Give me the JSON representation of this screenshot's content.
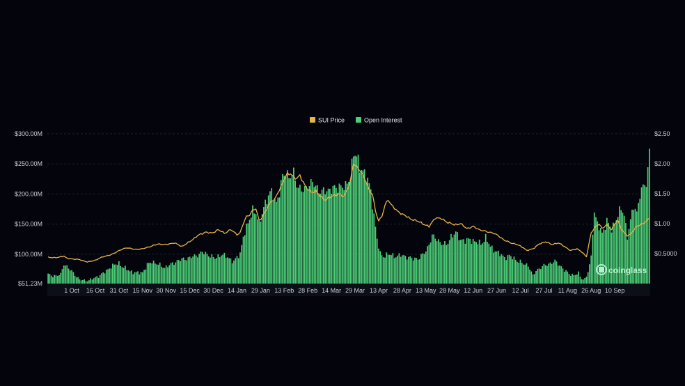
{
  "chart_data": {
    "type": "bar",
    "title": "",
    "legend": {
      "placement": "top-center",
      "items": [
        {
          "label": "SUI Price",
          "color": "#e8b44a"
        },
        {
          "label": "Open Interest",
          "color": "#4ccf78"
        }
      ]
    },
    "x_ticks": [
      "1 Oct",
      "16 Oct",
      "31 Oct",
      "15 Nov",
      "30 Nov",
      "15 Dec",
      "30 Dec",
      "14 Jan",
      "29 Jan",
      "13 Feb",
      "28 Feb",
      "14 Mar",
      "29 Mar",
      "13 Apr",
      "28 Apr",
      "13 May",
      "28 May",
      "12 Jun",
      "27 Jun",
      "12 Jul",
      "27 Jul",
      "11 Aug",
      "26 Aug",
      "10 Sep"
    ],
    "y_left": {
      "label": "",
      "ticks": [
        "$300.00M",
        "$250.00M",
        "$200.00M",
        "$150.00M",
        "$100.00M",
        "$51.23M"
      ],
      "tick_values": [
        300,
        250,
        200,
        150,
        100,
        51.23
      ],
      "range": [
        51.23,
        300
      ],
      "unit": "USD millions"
    },
    "y_right": {
      "label": "",
      "ticks": [
        "$2.50",
        "$2.00",
        "$1.50",
        "$1.00",
        "$0.5000"
      ],
      "tick_values": [
        2.5,
        2.0,
        1.5,
        1.0,
        0.5
      ],
      "range": [
        0,
        2.5
      ],
      "unit": "USD"
    },
    "grid": true,
    "series": [
      {
        "name": "Open Interest",
        "type": "bar",
        "axis": "left",
        "color": "#4ccf78",
        "anchors": [
          [
            0,
            66
          ],
          [
            3,
            64
          ],
          [
            8,
            66
          ],
          [
            10,
            84
          ],
          [
            12,
            80
          ],
          [
            14,
            74
          ],
          [
            17,
            66
          ],
          [
            20,
            58
          ],
          [
            23,
            56
          ],
          [
            26,
            57
          ],
          [
            30,
            61
          ],
          [
            34,
            67
          ],
          [
            37,
            72
          ],
          [
            40,
            80
          ],
          [
            45,
            85
          ],
          [
            48,
            78
          ],
          [
            52,
            72
          ],
          [
            56,
            69
          ],
          [
            60,
            70
          ],
          [
            63,
            82
          ],
          [
            66,
            88
          ],
          [
            70,
            83
          ],
          [
            74,
            78
          ],
          [
            78,
            83
          ],
          [
            82,
            89
          ],
          [
            86,
            92
          ],
          [
            90,
            94
          ],
          [
            94,
            98
          ],
          [
            98,
            103
          ],
          [
            102,
            99
          ],
          [
            106,
            93
          ],
          [
            110,
            100
          ],
          [
            114,
            95
          ],
          [
            118,
            88
          ],
          [
            122,
            101
          ],
          [
            124,
            130
          ],
          [
            127,
            150
          ],
          [
            130,
            175
          ],
          [
            132,
            168
          ],
          [
            134,
            148
          ],
          [
            137,
            180
          ],
          [
            140,
            195
          ],
          [
            142,
            205
          ],
          [
            145,
            185
          ],
          [
            147,
            200
          ],
          [
            149,
            230
          ],
          [
            151,
            240
          ],
          [
            153,
            225
          ],
          [
            156,
            235
          ],
          [
            159,
            210
          ],
          [
            162,
            205
          ],
          [
            165,
            215
          ],
          [
            168,
            218
          ],
          [
            171,
            210
          ],
          [
            174,
            203
          ],
          [
            177,
            205
          ],
          [
            180,
            210
          ],
          [
            183,
            208
          ],
          [
            186,
            215
          ],
          [
            189,
            210
          ],
          [
            192,
            230
          ],
          [
            194,
            270
          ],
          [
            196,
            260
          ],
          [
            198,
            245
          ],
          [
            200,
            240
          ],
          [
            202,
            230
          ],
          [
            205,
            205
          ],
          [
            207,
            165
          ],
          [
            209,
            125
          ],
          [
            211,
            100
          ],
          [
            213,
            97
          ],
          [
            216,
            100
          ],
          [
            220,
            97
          ],
          [
            224,
            98
          ],
          [
            228,
            96
          ],
          [
            232,
            92
          ],
          [
            236,
            94
          ],
          [
            240,
            105
          ],
          [
            244,
            130
          ],
          [
            247,
            125
          ],
          [
            250,
            118
          ],
          [
            253,
            115
          ],
          [
            256,
            130
          ],
          [
            259,
            135
          ],
          [
            262,
            125
          ],
          [
            265,
            122
          ],
          [
            268,
            125
          ],
          [
            272,
            120
          ],
          [
            275,
            117
          ],
          [
            278,
            128
          ],
          [
            281,
            112
          ],
          [
            284,
            106
          ],
          [
            287,
            100
          ],
          [
            290,
            95
          ],
          [
            293,
            97
          ],
          [
            296,
            93
          ],
          [
            299,
            88
          ],
          [
            302,
            84
          ],
          [
            305,
            82
          ],
          [
            307,
            70
          ],
          [
            308,
            64
          ],
          [
            310,
            73
          ],
          [
            313,
            78
          ],
          [
            316,
            82
          ],
          [
            319,
            85
          ],
          [
            322,
            88
          ],
          [
            325,
            82
          ],
          [
            328,
            73
          ],
          [
            331,
            68
          ],
          [
            334,
            65
          ],
          [
            337,
            68
          ],
          [
            339,
            60
          ],
          [
            341,
            58
          ],
          [
            343,
            70
          ],
          [
            345,
            95
          ],
          [
            346,
            140
          ],
          [
            347,
            170
          ],
          [
            349,
            150
          ],
          [
            352,
            135
          ],
          [
            355,
            155
          ],
          [
            358,
            140
          ],
          [
            361,
            160
          ],
          [
            364,
            175
          ],
          [
            366,
            165
          ],
          [
            368,
            130
          ],
          [
            370,
            155
          ],
          [
            372,
            180
          ],
          [
            374,
            170
          ],
          [
            376,
            200
          ],
          [
            378,
            210
          ],
          [
            380,
            220
          ],
          [
            381,
            240
          ],
          [
            382,
            275
          ]
        ]
      },
      {
        "name": "SUI Price",
        "type": "line",
        "axis": "right",
        "color": "#e8b44a",
        "anchors": [
          [
            0,
            0.44
          ],
          [
            5,
            0.43
          ],
          [
            10,
            0.46
          ],
          [
            12,
            0.42
          ],
          [
            16,
            0.41
          ],
          [
            20,
            0.4
          ],
          [
            25,
            0.36
          ],
          [
            30,
            0.39
          ],
          [
            35,
            0.45
          ],
          [
            40,
            0.48
          ],
          [
            45,
            0.55
          ],
          [
            50,
            0.6
          ],
          [
            55,
            0.57
          ],
          [
            60,
            0.58
          ],
          [
            65,
            0.62
          ],
          [
            70,
            0.66
          ],
          [
            75,
            0.65
          ],
          [
            80,
            0.68
          ],
          [
            85,
            0.62
          ],
          [
            90,
            0.7
          ],
          [
            95,
            0.8
          ],
          [
            100,
            0.86
          ],
          [
            104,
            0.84
          ],
          [
            108,
            0.9
          ],
          [
            112,
            0.84
          ],
          [
            116,
            0.9
          ],
          [
            120,
            0.82
          ],
          [
            122,
            0.85
          ],
          [
            124,
            1.0
          ],
          [
            126,
            1.12
          ],
          [
            128,
            1.15
          ],
          [
            130,
            1.22
          ],
          [
            132,
            1.25
          ],
          [
            134,
            1.06
          ],
          [
            136,
            1.1
          ],
          [
            138,
            1.2
          ],
          [
            140,
            1.3
          ],
          [
            142,
            1.39
          ],
          [
            144,
            1.4
          ],
          [
            146,
            1.52
          ],
          [
            148,
            1.62
          ],
          [
            150,
            1.75
          ],
          [
            152,
            1.82
          ],
          [
            154,
            1.84
          ],
          [
            156,
            1.78
          ],
          [
            158,
            1.75
          ],
          [
            160,
            1.8
          ],
          [
            162,
            1.7
          ],
          [
            164,
            1.6
          ],
          [
            167,
            1.52
          ],
          [
            170,
            1.55
          ],
          [
            173,
            1.45
          ],
          [
            176,
            1.4
          ],
          [
            180,
            1.45
          ],
          [
            184,
            1.5
          ],
          [
            188,
            1.45
          ],
          [
            192,
            1.7
          ],
          [
            194,
            2.0
          ],
          [
            196,
            1.95
          ],
          [
            198,
            1.9
          ],
          [
            200,
            1.8
          ],
          [
            202,
            1.7
          ],
          [
            204,
            1.55
          ],
          [
            206,
            1.5
          ],
          [
            208,
            1.2
          ],
          [
            210,
            1.05
          ],
          [
            212,
            1.12
          ],
          [
            214,
            1.3
          ],
          [
            216,
            1.4
          ],
          [
            218,
            1.32
          ],
          [
            222,
            1.2
          ],
          [
            226,
            1.15
          ],
          [
            230,
            1.08
          ],
          [
            234,
            1.05
          ],
          [
            238,
            1.0
          ],
          [
            242,
            0.95
          ],
          [
            246,
            1.1
          ],
          [
            250,
            1.08
          ],
          [
            254,
            1.02
          ],
          [
            258,
            0.98
          ],
          [
            262,
            1.0
          ],
          [
            266,
            0.92
          ],
          [
            270,
            0.95
          ],
          [
            274,
            0.9
          ],
          [
            278,
            0.87
          ],
          [
            282,
            0.85
          ],
          [
            286,
            0.8
          ],
          [
            290,
            0.72
          ],
          [
            294,
            0.68
          ],
          [
            298,
            0.65
          ],
          [
            302,
            0.6
          ],
          [
            304,
            0.55
          ],
          [
            308,
            0.58
          ],
          [
            312,
            0.66
          ],
          [
            316,
            0.7
          ],
          [
            320,
            0.65
          ],
          [
            324,
            0.68
          ],
          [
            328,
            0.62
          ],
          [
            332,
            0.55
          ],
          [
            336,
            0.58
          ],
          [
            338,
            0.55
          ],
          [
            340,
            0.5
          ],
          [
            342,
            0.45
          ],
          [
            345,
            0.85
          ],
          [
            348,
            0.95
          ],
          [
            350,
            1.0
          ],
          [
            352,
            0.92
          ],
          [
            355,
            0.98
          ],
          [
            358,
            0.9
          ],
          [
            360,
            1.0
          ],
          [
            362,
            1.05
          ],
          [
            364,
            0.92
          ],
          [
            366,
            0.85
          ],
          [
            368,
            0.8
          ],
          [
            370,
            0.82
          ],
          [
            372,
            0.9
          ],
          [
            374,
            0.95
          ],
          [
            376,
            0.98
          ],
          [
            378,
            1.0
          ],
          [
            380,
            1.05
          ],
          [
            382,
            1.08
          ]
        ]
      }
    ],
    "watermark": {
      "text": "coinglass",
      "icon": "coinglass-logo-icon"
    }
  }
}
